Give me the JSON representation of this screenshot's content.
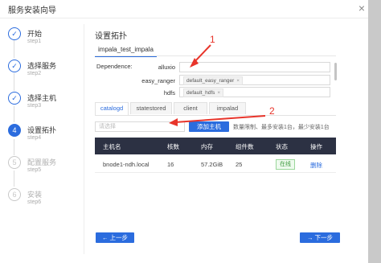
{
  "dialog": {
    "title": "服务安装向导",
    "close_glyph": "×"
  },
  "steps": [
    {
      "label": "开始",
      "sub": "step1",
      "state": "done"
    },
    {
      "label": "选择服务",
      "sub": "step2",
      "state": "done"
    },
    {
      "label": "选择主机",
      "sub": "step3",
      "state": "done"
    },
    {
      "label": "设置拓扑",
      "sub": "step4",
      "state": "active",
      "number": "4"
    },
    {
      "label": "配置服务",
      "sub": "step5",
      "state": "pending",
      "number": "5"
    },
    {
      "label": "安装",
      "sub": "step6",
      "state": "pending",
      "number": "6"
    }
  ],
  "section_title": "设置拓扑",
  "service_tab": "impala_test_impala",
  "dependence": {
    "label": "Dependence:",
    "rows": [
      {
        "name": "alluxio",
        "tag": ""
      },
      {
        "name": "easy_ranger",
        "tag": "default_easy_ranger"
      },
      {
        "name": "hdfs",
        "tag": "default_hdfs"
      }
    ],
    "tag_close": "×"
  },
  "role_tabs": [
    "catalogd",
    "statestored",
    "client",
    "impalad"
  ],
  "host_select": {
    "placeholder": "请选择"
  },
  "add_host_label": "添加主机",
  "hint": "数量限制、最多安装1台，最少安装1台",
  "table": {
    "headers": [
      "主机名",
      "核数",
      "内存",
      "组件数",
      "状态",
      "操作"
    ],
    "rows": [
      {
        "host": "bnode1-ndh.local",
        "cores": "16",
        "memory": "57.2GiB",
        "components": "25",
        "status": "在线",
        "action": "删除"
      }
    ]
  },
  "buttons": {
    "prev": "← 上一步",
    "next": "→ 下一步"
  },
  "annotations": [
    "1",
    "2"
  ],
  "colors": {
    "accent": "#2b6cde",
    "annotation": "#e8352b",
    "table_header": "#2c3143"
  }
}
